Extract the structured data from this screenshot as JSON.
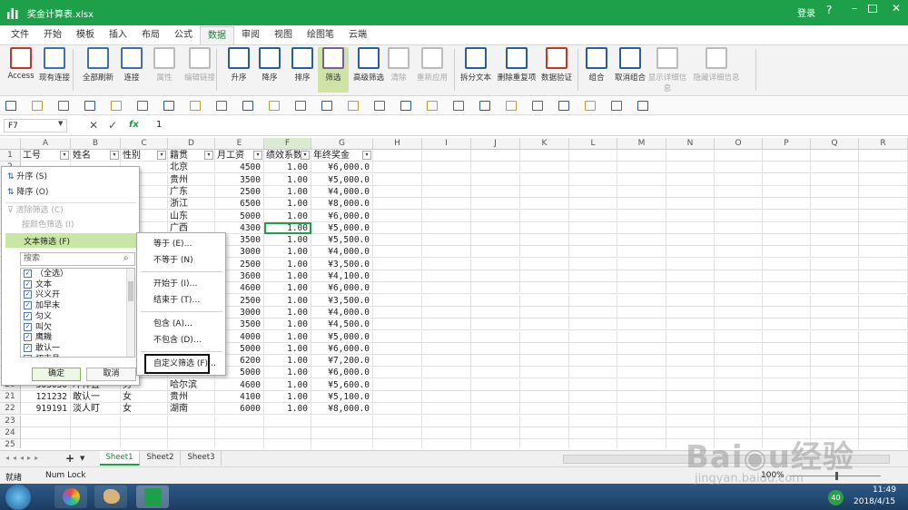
{
  "app": {
    "title": "奖金计算表.xlsx",
    "login": "登录",
    "help": "?"
  },
  "tabs": [
    "文件",
    "开始",
    "模板",
    "插入",
    "布局",
    "公式",
    "数据",
    "审阅",
    "视图",
    "绘图笔",
    "云端"
  ],
  "active_tab": "数据",
  "ribbon": [
    {
      "label": "Access",
      "icon": "access-icon",
      "color": "#c0392b"
    },
    {
      "label": "现有连接",
      "icon": "database-icon",
      "color": "#3f6fb0"
    },
    {
      "label": "全部刷新",
      "icon": "refresh-icon",
      "color": "#3f6fb0"
    },
    {
      "label": "连接",
      "icon": "link-icon",
      "color": "#3f6fb0"
    },
    {
      "label": "属性",
      "icon": "properties-icon",
      "color": "#bbbbbb"
    },
    {
      "label": "编辑链接",
      "icon": "edit-links-icon",
      "color": "#bbbbbb"
    },
    {
      "label": "升序",
      "icon": "sort-asc-icon",
      "color": "#2a5d9c"
    },
    {
      "label": "降序",
      "icon": "sort-desc-icon",
      "color": "#2a5d9c"
    },
    {
      "label": "排序",
      "icon": "sort-icon",
      "color": "#2a5d9c"
    },
    {
      "label": "筛选",
      "icon": "filter-icon",
      "color": "#7a5ca8"
    },
    {
      "label": "高级筛选",
      "icon": "advanced-filter-icon",
      "color": "#2a5d9c"
    },
    {
      "label": "清除",
      "icon": "clear-filter-icon",
      "color": "#bbbbbb"
    },
    {
      "label": "重新应用",
      "icon": "reapply-icon",
      "color": "#bbbbbb"
    },
    {
      "label": "拆分文本",
      "icon": "split-text-icon",
      "color": "#2a5d9c"
    },
    {
      "label": "删除重复项",
      "icon": "remove-duplicates-icon",
      "color": "#2a5d9c"
    },
    {
      "label": "数据验证",
      "icon": "data-validation-icon",
      "color": "#c0392b"
    },
    {
      "label": "组合",
      "icon": "group-icon",
      "color": "#2a5d9c"
    },
    {
      "label": "取消组合",
      "icon": "ungroup-icon",
      "color": "#2a5d9c"
    },
    {
      "label": "显示详细信息",
      "icon": "show-detail-icon",
      "color": "#bbbbbb"
    },
    {
      "label": "隐藏详细信息",
      "icon": "hide-detail-icon",
      "color": "#bbbbbb"
    }
  ],
  "formula_bar": {
    "cell_ref": "F7",
    "fx": "fx",
    "value": "1"
  },
  "columns": [
    "A",
    "B",
    "C",
    "D",
    "E",
    "F",
    "G",
    "H",
    "I",
    "J",
    "K",
    "L",
    "M",
    "N",
    "O",
    "P",
    "Q",
    "R"
  ],
  "rows": [
    "1",
    "2",
    "3",
    "4",
    "5",
    "6",
    "7",
    "8",
    "9",
    "10",
    "11",
    "12",
    "13",
    "14",
    "15",
    "16",
    "17",
    "18",
    "19",
    "20",
    "21",
    "22",
    "23",
    "24",
    "25",
    "26"
  ],
  "headers": [
    "工号",
    "姓名",
    "性别",
    "籍贯",
    "月工资",
    "绩效系数",
    "年终奖金"
  ],
  "table": [
    [
      "",
      "",
      "",
      "北京",
      "4500",
      "1.00",
      "¥6,000.0"
    ],
    [
      "",
      "",
      "",
      "贵州",
      "3500",
      "1.00",
      "¥5,000.0"
    ],
    [
      "",
      "",
      "",
      "广东",
      "2500",
      "1.00",
      "¥4,000.0"
    ],
    [
      "",
      "",
      "",
      "浙江",
      "6500",
      "1.00",
      "¥8,000.0"
    ],
    [
      "",
      "",
      "",
      "山东",
      "5000",
      "1.00",
      "¥6,000.0"
    ],
    [
      "",
      "",
      "",
      "广西",
      "4300",
      "1.00",
      "¥5,000.0"
    ],
    [
      "",
      "",
      "",
      "",
      "3500",
      "1.00",
      "¥5,500.0"
    ],
    [
      "",
      "",
      "",
      "",
      "3000",
      "1.00",
      "¥4,000.0"
    ],
    [
      "",
      "",
      "",
      "",
      "2500",
      "1.00",
      "¥3,500.0"
    ],
    [
      "",
      "",
      "",
      "",
      "3600",
      "1.00",
      "¥4,100.0"
    ],
    [
      "",
      "",
      "",
      "",
      "4600",
      "1.00",
      "¥6,000.0"
    ],
    [
      "",
      "",
      "",
      "",
      "2500",
      "1.00",
      "¥3,500.0"
    ],
    [
      "",
      "",
      "",
      "",
      "3000",
      "1.00",
      "¥4,000.0"
    ],
    [
      "",
      "",
      "",
      "",
      "3500",
      "1.00",
      "¥4,500.0"
    ],
    [
      "",
      "",
      "",
      "",
      "4000",
      "1.00",
      "¥5,000.0"
    ],
    [
      "",
      "",
      "",
      "",
      "5000",
      "1.00",
      "¥6,000.0"
    ],
    [
      "",
      "",
      "",
      "",
      "6200",
      "1.00",
      "¥7,200.0"
    ],
    [
      "",
      "",
      "",
      "",
      "5000",
      "1.00",
      "¥6,000.0"
    ],
    [
      "303030",
      "冲祥置",
      "男",
      "哈尔滨",
      "4600",
      "1.00",
      "¥5,600.0"
    ],
    [
      "121232",
      "敢认一",
      "女",
      "贵州",
      "4100",
      "1.00",
      "¥5,100.0"
    ],
    [
      "919191",
      "淡人盯",
      "女",
      "湖南",
      "6000",
      "1.00",
      "¥8,000.0"
    ]
  ],
  "filter_panel": {
    "sort_asc": "升序 (S)",
    "sort_desc": "降序 (O)",
    "clear": "清除筛选 (C)",
    "by_color": "按颜色筛选 (I)",
    "text_filter": "文本筛选 (F)",
    "search_placeholder": "搜索",
    "items": [
      "（全选）",
      "文本",
      "兴义开",
      "加早末",
      "匀义",
      "叫欠",
      "鹰耭",
      "敢认一",
      "忉吉昌"
    ],
    "ok": "确定",
    "cancel": "取消"
  },
  "submenu": [
    "等于 (E)…",
    "不等于 (N)",
    "开始于 (I)…",
    "结束于 (T)…",
    "包含 (A)…",
    "不包含 (D)…",
    "自定义筛选 (F)…"
  ],
  "sheets": [
    "Sheet1",
    "Sheet2",
    "Sheet3"
  ],
  "status": {
    "mode": "就绪",
    "numlock": "Num Lock",
    "zoom": "100%"
  },
  "taskbar": {
    "time": "11:49",
    "date": "2018/4/15",
    "badge": "40"
  },
  "watermark": "Baidu经验 jingyan.baidu.com"
}
